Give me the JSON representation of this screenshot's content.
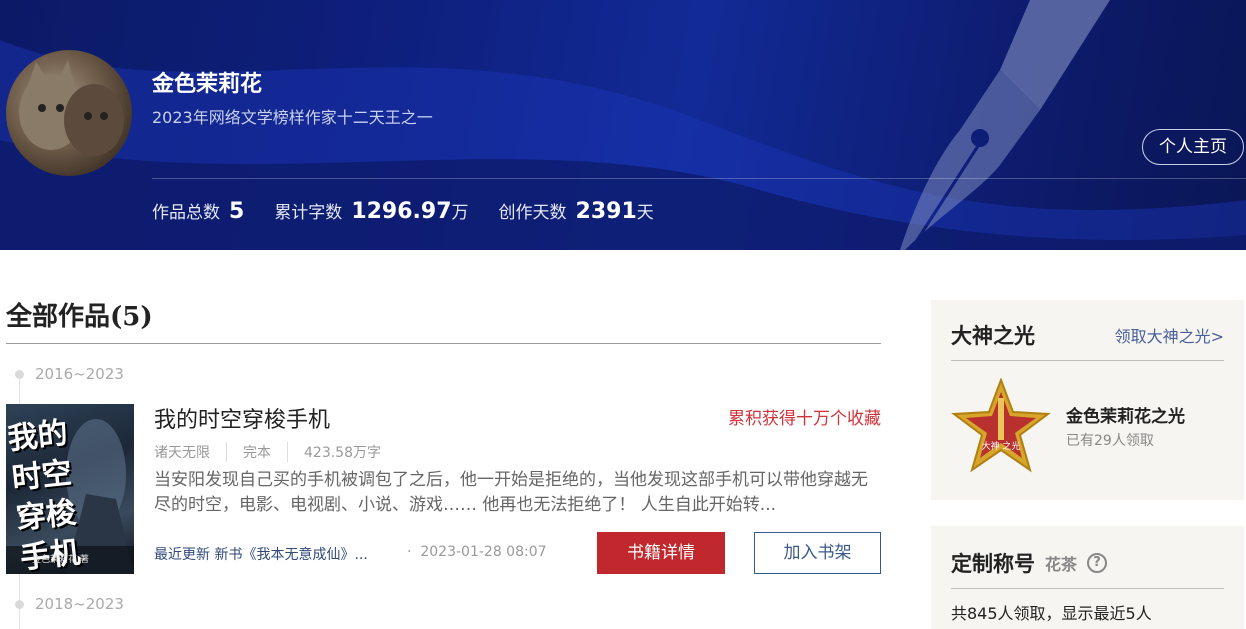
{
  "header": {
    "author_name": "金色茉莉花",
    "author_title": "2023年网络文学榜样作家十二天王之一",
    "home_button": "个人主页",
    "stats": [
      {
        "label": "作品总数",
        "value": "5",
        "unit": ""
      },
      {
        "label": "累计字数",
        "value": "1296.97",
        "unit": "万"
      },
      {
        "label": "创作天数",
        "value": "2391",
        "unit": "天"
      }
    ]
  },
  "works": {
    "heading": "全部作品(5)",
    "years": [
      "2016~2023",
      "2018~2023"
    ],
    "book": {
      "cover_title": "我的时空穿梭手机",
      "cover_author": "金色茉莉花 著",
      "title": "我的时空穿梭手机",
      "badge": "累积获得十万个收藏",
      "meta": [
        "诸天无限",
        "完本",
        "423.58万字"
      ],
      "description": "当安阳发现自己买的手机被调包了之后，他一开始是拒绝的，当他发现这部手机可以带他穿越无尽的时空，电影、电视剧、小说、游戏…… 他再也无法拒绝了！ 人生自此开始转...",
      "latest_update": "最近更新 新书《我本无意成仙》...",
      "update_time": "2023-01-28 08:07",
      "detail_button": "书籍详情",
      "shelf_button": "加入书架"
    }
  },
  "sidebar": {
    "glory": {
      "title": "大神之光",
      "link": "领取大神之光>",
      "badge_text": "大神 之光",
      "badge_name": "金色茉莉花之光",
      "badge_count": "已有29人领取"
    },
    "custom_title": {
      "title": "定制称号",
      "sub": "花茶",
      "help": "?",
      "count": "共845人领取，显示最近5人"
    }
  },
  "colors": {
    "banner": "#0e1f7c",
    "accent_red": "#c0282e",
    "link_blue": "#4a5f9a",
    "gold": "#d6a52a"
  }
}
